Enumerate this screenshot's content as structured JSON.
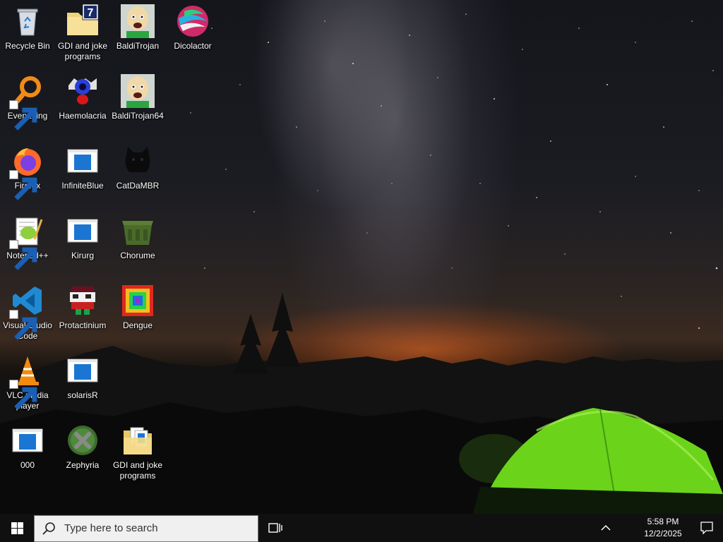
{
  "desktop": {
    "icons": [
      {
        "label": "Recycle Bin",
        "icon": "recycle-bin-icon"
      },
      {
        "label": "GDI and joke programs",
        "icon": "folder-icon"
      },
      {
        "label": "BaldiTrojan",
        "icon": "baldi-face-icon"
      },
      {
        "label": "Dicolactor",
        "icon": "swirl-sphere-icon"
      },
      {
        "label": "Everything",
        "icon": "magnifier-icon"
      },
      {
        "label": "Haemolacria",
        "icon": "eye-creature-icon"
      },
      {
        "label": "BaldiTrojan64",
        "icon": "baldi-face-icon"
      },
      {
        "label": "Firefox",
        "icon": "firefox-icon"
      },
      {
        "label": "InfiniteBlue",
        "icon": "app-window-icon"
      },
      {
        "label": "CatDaMBR",
        "icon": "black-cat-icon"
      },
      {
        "label": "Notepad++",
        "icon": "notepad-plus-plus-icon"
      },
      {
        "label": "Kirurg",
        "icon": "app-window-icon"
      },
      {
        "label": "Chorume",
        "icon": "dumpster-icon"
      },
      {
        "label": "Visual Studio Code",
        "icon": "vscode-icon"
      },
      {
        "label": "Protactinium",
        "icon": "pixel-character-icon"
      },
      {
        "label": "Dengue",
        "icon": "rainbow-square-icon"
      },
      {
        "label": "VLC media player",
        "icon": "vlc-cone-icon"
      },
      {
        "label": "solarisR",
        "icon": "app-window-icon"
      },
      {
        "label": "000",
        "icon": "app-window-icon"
      },
      {
        "label": "Zephyria",
        "icon": "green-x-icon"
      },
      {
        "label": "GDI and joke programs",
        "icon": "folder-files-icon"
      }
    ]
  },
  "taskbar": {
    "search_placeholder": "Type here to search",
    "time": "5:58 PM",
    "date": "12/2/2025"
  }
}
